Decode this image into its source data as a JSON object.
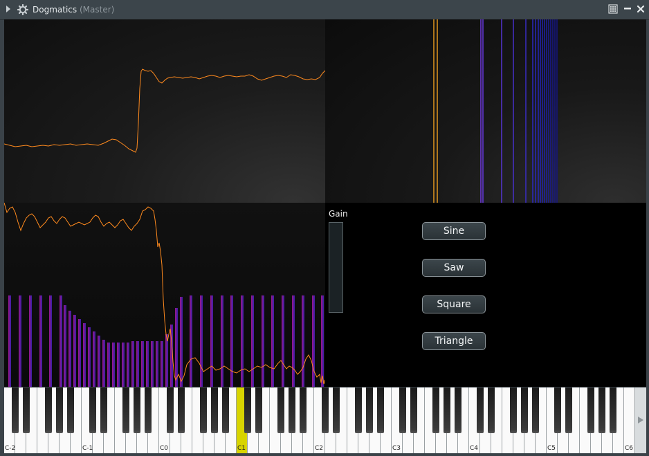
{
  "window": {
    "title": "Dogmatics",
    "subtitle": "(Master)",
    "colors": {
      "titlebar": "#3c454b",
      "accent_wave": "#ff8a1e",
      "accent_key": "#d8d400"
    }
  },
  "controls": {
    "gain_label": "Gain",
    "gain_level": 0.0,
    "buttons": [
      "Sine",
      "Saw",
      "Square",
      "Triangle"
    ]
  },
  "keyboard": {
    "octave_labels": [
      "C-2",
      "C-1",
      "C0",
      "C1",
      "C2",
      "C3",
      "C4",
      "C5",
      "C6"
    ],
    "highlighted_key": "C1"
  },
  "icons": {
    "expand": "triangle-right-icon",
    "plugin": "gear-icon",
    "grid": "grid-icon",
    "minimize": "minimize-icon",
    "close": "close-icon",
    "scroll": "scroll-right-icon"
  }
}
